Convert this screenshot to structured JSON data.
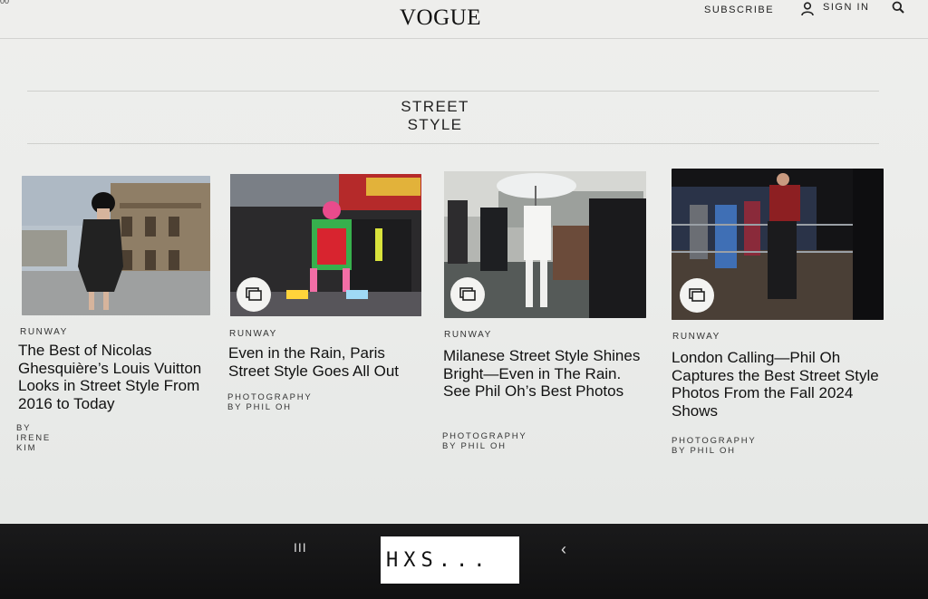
{
  "status_bar": {
    "time": "00"
  },
  "header": {
    "logo": "VOGUE",
    "subscribe": "SUBSCRIBE",
    "sign_in": "SIGN IN",
    "icons": [
      "user-icon",
      "search-icon"
    ]
  },
  "section": {
    "title_line1": "STREET",
    "title_line2": "STYLE"
  },
  "cards": [
    {
      "category": "RUNWAY",
      "headline": "The Best of Nicolas Ghesquière’s Louis Vuitton Looks in Street Style From 2016 to Today",
      "byline": "BY IRENE KIM",
      "gallery": false
    },
    {
      "category": "RUNWAY",
      "headline": "Even in the Rain, Paris Street Style Goes All Out",
      "byline": "PHOTOGRAPHY BY PHIL OH",
      "gallery": true
    },
    {
      "category": "RUNWAY",
      "headline": "Milanese Street Style Shines Bright—Even in The Rain. See Phil Oh’s Best Photos",
      "byline": "PHOTOGRAPHY BY PHIL OH",
      "gallery": true
    },
    {
      "category": "RUNWAY",
      "headline": "London Calling—Phil Oh Captures the Best Street Style Photos From the Fall 2024 Shows",
      "byline": "PHOTOGRAPHY BY PHIL OH",
      "gallery": true
    }
  ],
  "system_nav": {
    "recent": "III",
    "back": "‹"
  },
  "overlay_text": "HXS..."
}
